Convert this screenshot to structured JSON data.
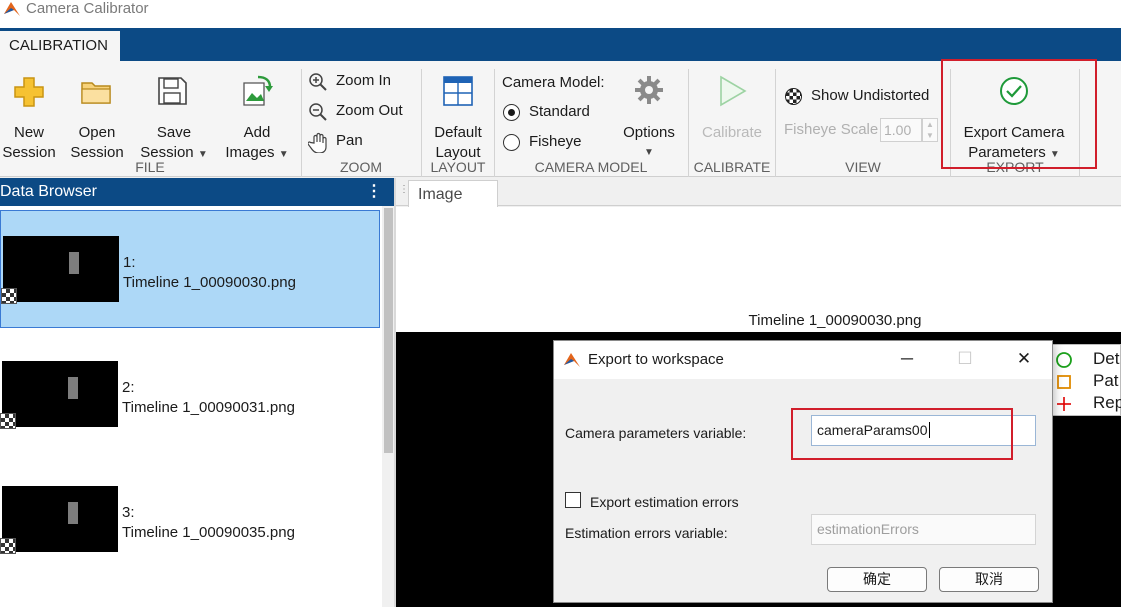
{
  "app": {
    "title": "Camera Calibrator"
  },
  "tabs": {
    "calibration": "CALIBRATION"
  },
  "toolstrip": {
    "file": {
      "new_session": [
        "New",
        "Session"
      ],
      "open_session": [
        "Open",
        "Session"
      ],
      "save_session": [
        "Save",
        "Session"
      ],
      "add_images": [
        "Add",
        "Images"
      ],
      "section": "FILE"
    },
    "zoom": {
      "zoom_in": "Zoom In",
      "zoom_out": "Zoom Out",
      "pan": "Pan",
      "section": "ZOOM"
    },
    "layout": {
      "default_layout": [
        "Default",
        "Layout"
      ],
      "section": "LAYOUT"
    },
    "camera_model": {
      "label": "Camera Model:",
      "standard": "Standard",
      "fisheye": "Fisheye",
      "selected": "Standard",
      "options": "Options",
      "section": "CAMERA MODEL"
    },
    "calibrate": {
      "calibrate": "Calibrate",
      "section": "CALIBRATE"
    },
    "view": {
      "show_undistorted": "Show Undistorted",
      "fisheye_scale_label": "Fisheye Scale",
      "fisheye_scale_value": "1.00",
      "section": "VIEW"
    },
    "export": {
      "export_params": [
        "Export Camera",
        "Parameters"
      ],
      "section": "EXPORT"
    }
  },
  "data_browser": {
    "title": "Data Browser",
    "items": [
      {
        "index": "1:",
        "name": "Timeline 1_00090030.png",
        "selected": true
      },
      {
        "index": "2:",
        "name": "Timeline 1_00090031.png",
        "selected": false
      },
      {
        "index": "3:",
        "name": "Timeline 1_00090035.png",
        "selected": false
      }
    ]
  },
  "image_pane": {
    "tab": "Image",
    "title": "Timeline 1_00090030.png",
    "legend": [
      "Det",
      "Pat",
      "Rep"
    ]
  },
  "dialog": {
    "title": "Export to workspace",
    "camera_params_label": "Camera parameters variable:",
    "camera_params_value": "cameraParams00",
    "export_errors_label": "Export estimation errors",
    "export_errors_checked": false,
    "errors_var_label": "Estimation errors variable:",
    "errors_var_value": "estimationErrors",
    "ok": "确定",
    "cancel": "取消"
  },
  "colors": {
    "brand_blue": "#0c4a85",
    "selection": "#add8f7",
    "highlight_red": "#d11e2b",
    "legend_detected": "#1aa01a",
    "legend_pattern": "#e08a00",
    "legend_reprojected": "#e00000"
  }
}
